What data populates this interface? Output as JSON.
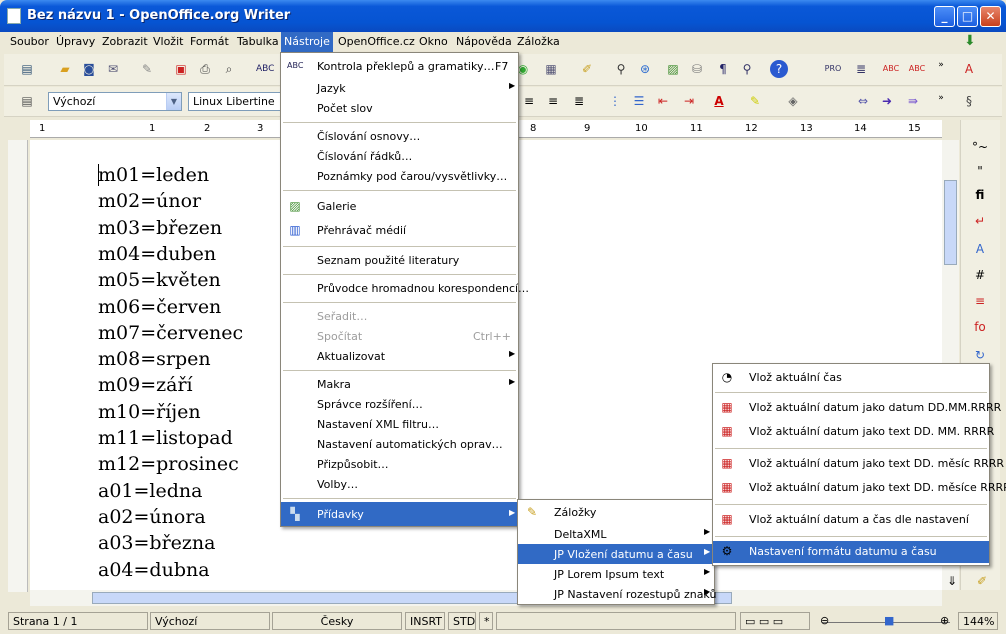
{
  "window": {
    "title": "Bez názvu 1 - OpenOffice.org Writer",
    "min": "_",
    "max": "□",
    "close": "✕"
  },
  "menubar": [
    "Soubor",
    "Úpravy",
    "Zobrazit",
    "Vložit",
    "Formát",
    "Tabulka",
    "Nástroje",
    "OpenOffice.cz",
    "Okno",
    "Nápověda",
    "Záložka"
  ],
  "formatting": {
    "style": "Výchozí",
    "font": "Linux Libertine"
  },
  "ruler": [
    "1",
    "1",
    "2",
    "3",
    "8",
    "9",
    "10",
    "11",
    "12",
    "13",
    "14",
    "15"
  ],
  "document_lines": [
    "m01=leden",
    "m02=únor",
    "m03=březen",
    "m04=duben",
    "m05=květen",
    "m06=červen",
    "m07=červenec",
    "m08=srpen",
    "m09=září",
    "m10=říjen",
    "m11=listopad",
    "m12=prosinec",
    "a01=ledna",
    "a02=února",
    "a03=března",
    "a04=dubna"
  ],
  "tools_menu": {
    "items": [
      {
        "label": "Kontrola překlepů a gramatiky…",
        "shortcut": "F7",
        "icon": "spellcheck-icon"
      },
      {
        "label": "Jazyk",
        "submenu": true
      },
      {
        "label": "Počet slov"
      },
      {
        "label": "Číslování osnovy…"
      },
      {
        "label": "Číslování řádků…"
      },
      {
        "label": "Poznámky pod čarou/vysvětlivky…"
      },
      {
        "label": "Galerie",
        "icon": "gallery-icon"
      },
      {
        "label": "Přehrávač médií",
        "icon": "media-player-icon"
      },
      {
        "label": "Seznam použité literatury"
      },
      {
        "label": "Průvodce hromadnou korespondencí…"
      },
      {
        "label": "Seřadit…",
        "disabled": true
      },
      {
        "label": "Spočítat",
        "shortcut": "Ctrl++",
        "disabled": true
      },
      {
        "label": "Aktualizovat",
        "submenu": true
      },
      {
        "label": "Makra",
        "submenu": true
      },
      {
        "label": "Správce rozšíření…"
      },
      {
        "label": "Nastavení XML filtru…"
      },
      {
        "label": "Nastavení automatických oprav…"
      },
      {
        "label": "Přizpůsobit…"
      },
      {
        "label": "Volby…"
      },
      {
        "label": "Přídavky",
        "submenu": true,
        "icon": "addons-icon"
      }
    ]
  },
  "addons_menu": {
    "items": [
      {
        "label": "Záložky",
        "icon": "bookmarks-icon"
      },
      {
        "label": "DeltaXML",
        "submenu": true
      },
      {
        "label": "JP Vložení datumu a času",
        "submenu": true
      },
      {
        "label": "JP Lorem Ipsum text",
        "submenu": true
      },
      {
        "label": "JP Nastavení rozestupů znaků",
        "submenu": true
      }
    ]
  },
  "date_menu": {
    "items": [
      {
        "label": "Vlož aktuální čas",
        "icon": "clock-icon"
      },
      {
        "label": "Vlož aktuální datum jako datum DD.MM.RRRR",
        "icon": "calendar-icon"
      },
      {
        "label": "Vlož aktuální datum jako text DD. MM. RRRR",
        "icon": "calendar-icon"
      },
      {
        "label": "Vlož aktuální datum jako text DD. měsíc RRRR",
        "icon": "calendar-icon"
      },
      {
        "label": "Vlož aktuální datum jako text DD. měsíce RRRR",
        "icon": "calendar-icon"
      },
      {
        "label": "Vlož aktuální datum a čas dle nastavení",
        "icon": "calendar-icon"
      },
      {
        "label": "Nastavení formátu datumu a času",
        "icon": "settings-icon"
      }
    ]
  },
  "statusbar": {
    "page": "Strana 1 / 1",
    "style": "Výchozí",
    "language": "Česky",
    "mode": "INSRT",
    "sel": "STD",
    "mod": "*",
    "zoom": "144%"
  }
}
